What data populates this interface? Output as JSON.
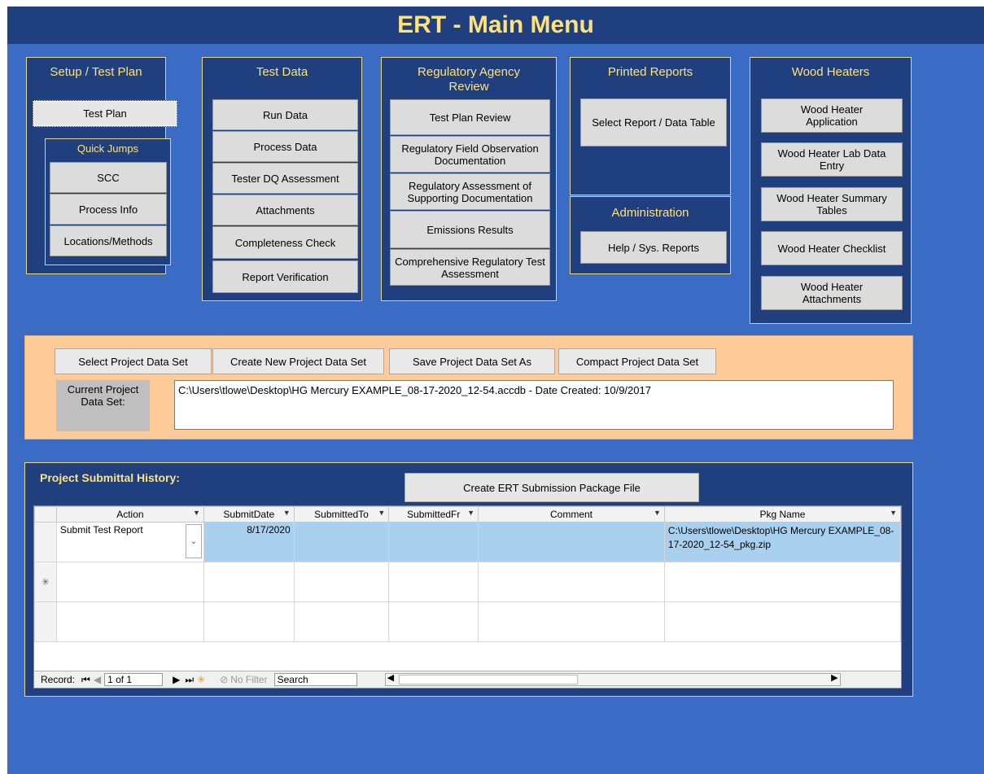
{
  "app": {
    "title": "ERT - Main Menu"
  },
  "panels": {
    "setup": {
      "title": "Setup / Test Plan",
      "test_plan": "Test Plan",
      "quick_jumps": "Quick Jumps",
      "scc": "SCC",
      "process_info": "Process Info",
      "locations": "Locations/Methods"
    },
    "test_data": {
      "title": "Test Data",
      "run_data": "Run Data",
      "process_data": "Process Data",
      "tester_dq": "Tester DQ Assessment",
      "attachments": "Attachments",
      "completeness": "Completeness Check",
      "report_verification": "Report Verification"
    },
    "regulatory": {
      "title": "Regulatory Agency Review",
      "test_plan_review": "Test Plan Review",
      "field_obs": "Regulatory Field Observation Documentation",
      "assessment": "Regulatory Assessment of Supporting Documentation",
      "emissions": "Emissions Results",
      "comprehensive": "Comprehensive Regulatory Test Assessment"
    },
    "printed": {
      "title": "Printed Reports",
      "select_report": "Select Report / Data Table"
    },
    "admin": {
      "title": "Administration",
      "help": "Help / Sys. Reports"
    },
    "wood": {
      "title": "Wood Heaters",
      "application": "Wood Heater Application",
      "lab": "Wood Heater Lab Data Entry",
      "summary": "Wood Heater Summary Tables",
      "checklist": "Wood Heater Checklist",
      "attachments": "Wood Heater Attachments"
    }
  },
  "project": {
    "select": "Select Project Data Set",
    "create": "Create New Project Data Set",
    "save_as": "Save Project Data Set As",
    "compact": "Compact Project Data Set",
    "current_label": "Current Project Data Set:",
    "current_value": "C:\\Users\\tlowe\\Desktop\\HG Mercury EXAMPLE_08-17-2020_12-54.accdb - Date Created: 10/9/2017"
  },
  "history": {
    "title": "Project Submittal History:",
    "create_pkg": "Create ERT Submission Package File",
    "columns": {
      "action": "Action",
      "submit_date": "SubmitDate",
      "submitted_to": "SubmittedTo",
      "submitted_fr": "SubmittedFr",
      "comment": "Comment",
      "pkg_name": "Pkg Name"
    },
    "row": {
      "action": "Submit Test Report",
      "submit_date": "8/17/2020",
      "pkg_name": "C:\\Users\\tlowe\\Desktop\\HG Mercury EXAMPLE_08-17-2020_12-54_pkg.zip"
    },
    "new_row_marker": "✳",
    "nav": {
      "record_label": "Record:",
      "record_value": "1 of 1",
      "no_filter": "No Filter",
      "search": "Search"
    }
  },
  "colors": {
    "background": "#3a6cc6",
    "panel": "#1f3f7e",
    "title": "#ffe27a",
    "project_bar": "#ffcc99"
  }
}
